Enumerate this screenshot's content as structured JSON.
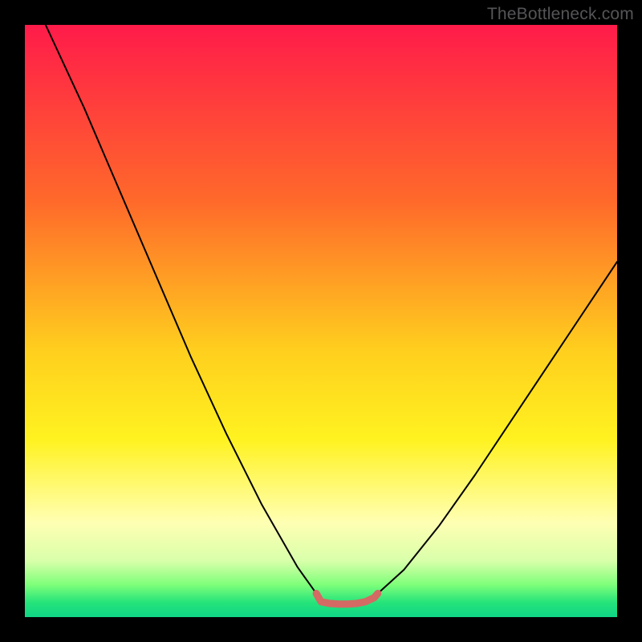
{
  "watermark": "TheBottleneck.com",
  "chart_data": {
    "type": "line",
    "title": "",
    "xlabel": "",
    "ylabel": "",
    "xlim": [
      0,
      100
    ],
    "ylim": [
      0,
      100
    ],
    "grid": false,
    "legend": false,
    "gradient_stops": [
      {
        "offset": 0,
        "color": "#ff1b4a"
      },
      {
        "offset": 0.3,
        "color": "#ff6a2a"
      },
      {
        "offset": 0.55,
        "color": "#ffcf1e"
      },
      {
        "offset": 0.7,
        "color": "#fff220"
      },
      {
        "offset": 0.84,
        "color": "#ffffb3"
      },
      {
        "offset": 0.905,
        "color": "#d9ffaa"
      },
      {
        "offset": 0.945,
        "color": "#7fff7a"
      },
      {
        "offset": 0.975,
        "color": "#26e47a"
      },
      {
        "offset": 1.0,
        "color": "#0fd585"
      }
    ],
    "series": [
      {
        "name": "curve-left",
        "stroke": "#000000",
        "stroke_width": 2,
        "x": [
          3.5,
          10,
          16,
          22,
          28,
          34,
          40,
          46,
          49.2
        ],
        "y": [
          100,
          86,
          72,
          58,
          44,
          31,
          19,
          8.5,
          4.0
        ]
      },
      {
        "name": "curve-right",
        "stroke": "#000000",
        "stroke_width": 2,
        "x": [
          59.6,
          64,
          70,
          76,
          82,
          88,
          94,
          100
        ],
        "y": [
          4.0,
          8.0,
          15.5,
          24,
          33,
          42,
          51,
          60
        ]
      },
      {
        "name": "flat-segment",
        "stroke": "#d36a63",
        "stroke_width": 9,
        "x": [
          49.2,
          50,
          51.5,
          53,
          54.5,
          56,
          57.5,
          59,
          59.6
        ],
        "y": [
          4.0,
          2.6,
          2.3,
          2.2,
          2.2,
          2.3,
          2.6,
          3.3,
          4.0
        ]
      }
    ]
  }
}
